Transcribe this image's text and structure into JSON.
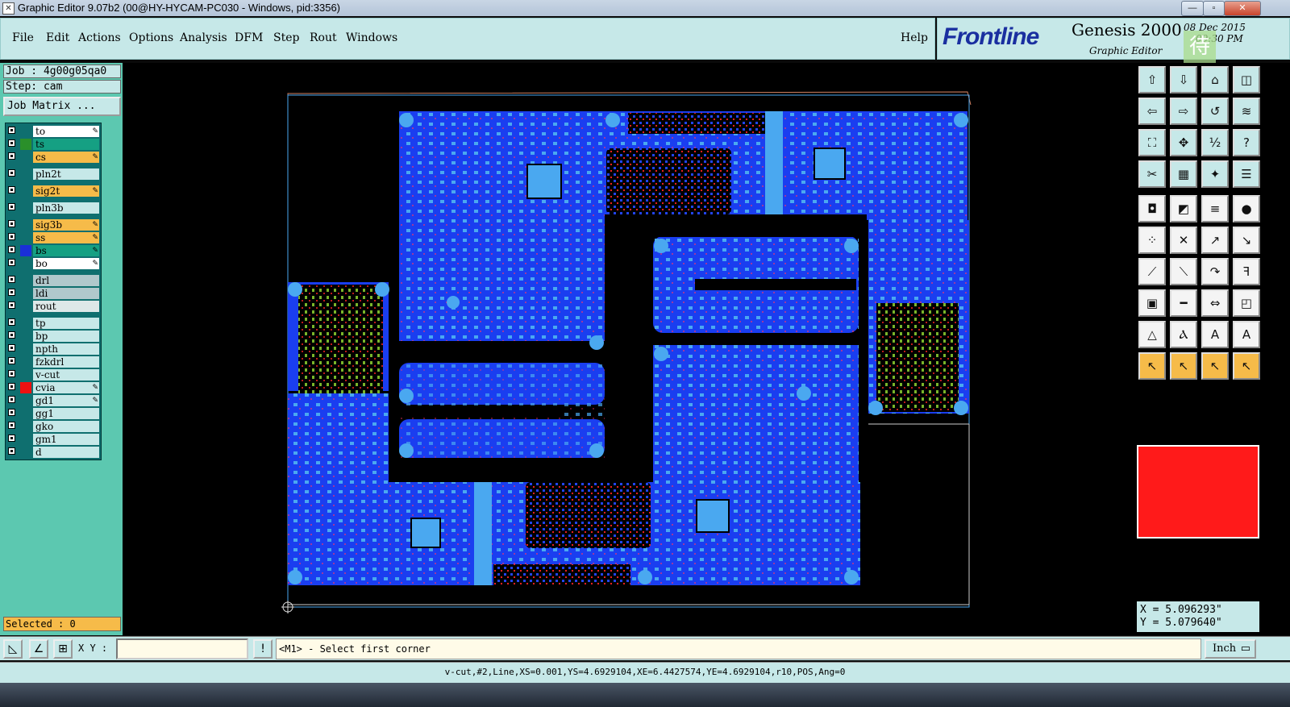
{
  "window": {
    "title": "Graphic Editor 9.07b2 (00@HY-HYCAM-PC030 - Windows, pid:3356)",
    "icon": "x-icon"
  },
  "menu": {
    "items": [
      "File",
      "Edit",
      "Actions",
      "Options",
      "Analysis",
      "DFM",
      "Step",
      "Rout",
      "Windows"
    ],
    "help": "Help"
  },
  "brand": {
    "logo": "Frontline",
    "product": "Genesis 2000",
    "subtitle": "Graphic Editor",
    "date": "08 Dec 2015",
    "time": "09:30 PM",
    "badge": "待"
  },
  "job": {
    "job_line": "Job : 4g00g05qa0",
    "step_line": "Step: cam",
    "matrix_button": "Job Matrix ..."
  },
  "layers": [
    {
      "name": "to",
      "swatch": "",
      "bg": "#ffffff",
      "editable": true
    },
    {
      "name": "ts",
      "swatch": "#2a8f2a",
      "bg": "#15a083",
      "editable": false
    },
    {
      "name": "cs",
      "swatch": "",
      "bg": "#f6bb49",
      "editable": true
    },
    {
      "name": "pln2t",
      "swatch": "",
      "bg": "#c6e8e8",
      "editable": false
    },
    {
      "name": "sig2t",
      "swatch": "",
      "bg": "#f6bb49",
      "editable": true
    },
    {
      "name": "pln3b",
      "swatch": "",
      "bg": "#c6e8e8",
      "editable": false
    },
    {
      "name": "sig3b",
      "swatch": "",
      "bg": "#f6bb49",
      "editable": true
    },
    {
      "name": "ss",
      "swatch": "",
      "bg": "#f6bb49",
      "editable": true
    },
    {
      "name": "bs",
      "swatch": "#1a2fd8",
      "bg": "#15a083",
      "editable": true
    },
    {
      "name": "bo",
      "swatch": "",
      "bg": "#ffffff",
      "editable": true
    },
    {
      "name": "drl",
      "swatch": "",
      "bg": "#b0c8cc",
      "editable": false
    },
    {
      "name": "ldi",
      "swatch": "",
      "bg": "#b0c8cc",
      "editable": false
    },
    {
      "name": "rout",
      "swatch": "",
      "bg": "#dde8e8",
      "editable": false
    },
    {
      "name": "tp",
      "swatch": "",
      "bg": "#c6e8e8",
      "editable": false
    },
    {
      "name": "bp",
      "swatch": "",
      "bg": "#c6e8e8",
      "editable": false
    },
    {
      "name": "npth",
      "swatch": "",
      "bg": "#c6e8e8",
      "editable": false
    },
    {
      "name": "fzkdrl",
      "swatch": "",
      "bg": "#c6e8e8",
      "editable": false
    },
    {
      "name": "v-cut",
      "swatch": "",
      "bg": "#c6e8e8",
      "editable": false
    },
    {
      "name": "cvia",
      "swatch": "#ee1111",
      "bg": "#c6e8e8",
      "editable": true
    },
    {
      "name": "gd1",
      "swatch": "",
      "bg": "#c6e8e8",
      "editable": true
    },
    {
      "name": "gg1",
      "swatch": "",
      "bg": "#c6e8e8",
      "editable": false
    },
    {
      "name": "gko",
      "swatch": "",
      "bg": "#c6e8e8",
      "editable": false
    },
    {
      "name": "gm1",
      "swatch": "",
      "bg": "#c6e8e8",
      "editable": false
    },
    {
      "name": "d",
      "swatch": "",
      "bg": "#c6e8e8",
      "editable": false
    }
  ],
  "selected": "Selected : 0",
  "coords": {
    "x": "X = 5.096293\"",
    "y": "Y = 5.079640\""
  },
  "command": {
    "xy_label": "X Y :",
    "xy_value": "",
    "prompt": "<M1> - Select first corner",
    "units": "Inch"
  },
  "status": "v-cut,#2,Line,XS=0.001,YS=4.6929104,XE=6.4427574,YE=4.6929104,r10,POS,Ang=0",
  "colors": {
    "panel": "#c6e8e8",
    "sidebar": "#5cc8b0",
    "copper": "#1a3ef0",
    "pads": "#4aa8f0",
    "minimap": "#ff1a1a",
    "highlight": "#f6bb49"
  },
  "tools": [
    "zoom-home-icon",
    "zoom-in-icon",
    "home-icon",
    "window-icon",
    "pan-left-icon",
    "pan-right-icon",
    "redraw-icon",
    "fill-icon",
    "fit-icon",
    "center-icon",
    "scale-1-2-icon",
    "help-icon",
    "measure-icon",
    "grid-icon",
    "snap-icon",
    "layers-icon",
    "capture-icon",
    "select-box-icon",
    "ruler-icon",
    "dot-icon",
    "connect-icon",
    "cross-icon",
    "move-icon",
    "edge-icon",
    "line-red-icon",
    "line-diag-icon",
    "arc-icon",
    "ff-icon",
    "add-pad-icon",
    "minus-icon",
    "fit-width-icon",
    "copy-icon",
    "triangle-icon",
    "a-icon",
    "a-underline-icon",
    "a-text-icon",
    "pointer-icon",
    "pointer-box-icon",
    "pointer-circle-icon",
    "pointer-stairs-icon"
  ]
}
